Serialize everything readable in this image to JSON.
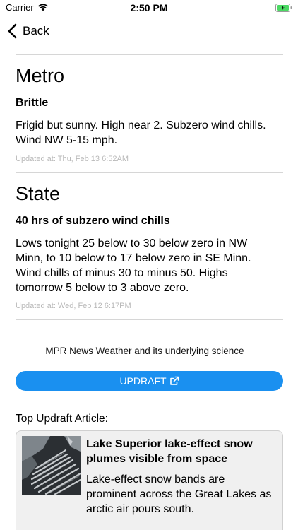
{
  "status_bar": {
    "carrier": "Carrier",
    "time": "2:50 PM",
    "battery_color": "#4cd964"
  },
  "nav": {
    "back_label": "Back"
  },
  "metro": {
    "title": "Metro",
    "headline": "Brittle",
    "forecast": "Frigid but sunny. High near 2. Subzero wind chills. Wind NW 5-15 mph.",
    "updated": "Updated at:  Thu, Feb 13 6:52AM"
  },
  "state": {
    "title": "State",
    "headline": "40 hrs of subzero wind chills",
    "forecast": "Lows tonight 25 below to 30 below zero in NW Minn, to 10 below to 17 below zero in SE Minn. Wind chills of minus 30 to minus 50. Highs tomorrow 5 below to 3 above zero.",
    "updated": "Updated at: Wed, Feb 12 6:17PM"
  },
  "updraft": {
    "tagline": "MPR News Weather and its underlying science",
    "button_label": "UPDRAFT",
    "button_color": "#1a90f0",
    "icon": "external-link-icon"
  },
  "top_article": {
    "label": "Top Updraft Article:",
    "title": "Lake Superior lake-effect snow plumes visible from space",
    "description": "Lake-effect snow bands are prominent across the Great Lakes as arctic air pours south."
  }
}
